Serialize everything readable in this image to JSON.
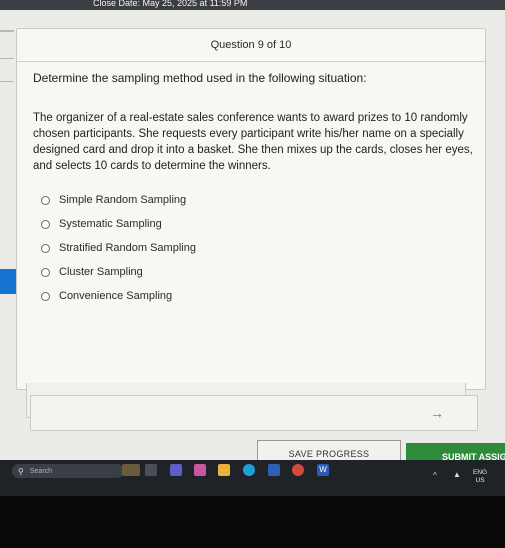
{
  "status_bar": {
    "close_date": "Close Date: May 25, 2025 at 11:59 PM"
  },
  "question": {
    "counter": "Question 9 of 10",
    "prompt": "Determine the sampling method used in the following situation:",
    "scenario": "The organizer of a real-estate sales conference wants to award prizes to 10 randomly chosen participants. She requests every participant write his/her name on a specially designed card and drop it into a basket. She then mixes up the cards, closes her eyes, and selects 10 cards to determine the winners.",
    "options": [
      {
        "label": "Simple Random Sampling"
      },
      {
        "label": "Systematic Sampling"
      },
      {
        "label": "Stratified Random Sampling"
      },
      {
        "label": "Cluster Sampling"
      },
      {
        "label": "Convenience Sampling"
      }
    ]
  },
  "navigation": {
    "back_icon": "←",
    "next_icon": "→",
    "save_label": "SAVE PROGRESS",
    "submit_label": "SUBMIT ASSIG"
  },
  "taskbar": {
    "search_placeholder": "Search",
    "search_icon": "⚲",
    "language": "ENG",
    "region": "US",
    "icons": [
      {
        "name": "widgets-icon",
        "color": "#6b5b3e",
        "glyph": ""
      },
      {
        "name": "task-view-icon",
        "color": "#4a4f56",
        "glyph": ""
      },
      {
        "name": "teams-icon",
        "color": "#5b61c9",
        "glyph": ""
      },
      {
        "name": "copilot-icon",
        "color": "#c9579d",
        "glyph": ""
      },
      {
        "name": "file-explorer-icon",
        "color": "#e8b23a",
        "glyph": ""
      },
      {
        "name": "edge-icon",
        "color": "#1e9fd8",
        "glyph": ""
      },
      {
        "name": "store-icon",
        "color": "#2e5fb7",
        "glyph": ""
      },
      {
        "name": "chrome-icon",
        "color": "#d64a3c",
        "glyph": ""
      },
      {
        "name": "word-icon",
        "color": "#2b5bb8",
        "glyph": "W"
      }
    ]
  },
  "colors": {
    "accent": "#1774d1",
    "submit_green": "#2e8b3a",
    "taskbar": "#1f2327"
  }
}
